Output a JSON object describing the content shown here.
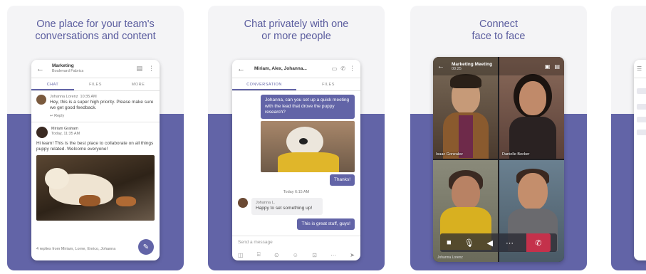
{
  "cards": [
    {
      "title_line1": "One place for your team's",
      "title_line2": "conversations and content",
      "phone": {
        "channel_name": "Marketing",
        "channel_sub": "Boulevard Fabrics",
        "tabs": [
          "CHAT",
          "FILES",
          "MORE"
        ],
        "post1_author": "Johanna Lorenz",
        "post1_time": "10:35 AM",
        "post1_text": "Hey, this is a super high priority. Please make sure we get good feedback.",
        "reply_label": "Reply",
        "post2_author": "Miriam Graham",
        "post2_time": "Today, 11:35 AM",
        "post2_text": "Hi team! This is the best place to collaborate on all things puppy related. Welcome everyone!",
        "likes_text": "4 replies from Miriam, Lorne, Enrico, Johanna"
      }
    },
    {
      "title_line1": "Chat privately with one",
      "title_line2": "or more people",
      "phone": {
        "chat_name": "Miriam, Alex, Johanna...",
        "tabs": [
          "CONVERSATION",
          "FILES"
        ],
        "msg1": "Johanna, can you set up a quick meeting with the lead that drove the puppy research?",
        "msg2": "Thanks!",
        "time_sep": "Today 6:15 AM",
        "reply_author": "Johanna L.",
        "reply_text": "Happy to set something up!",
        "msg3": "This is great stuff, guys!",
        "compose_placeholder": "Send a message"
      }
    },
    {
      "title_line1": "Connect",
      "title_line2": "face to face",
      "phone": {
        "meeting_title": "Marketing Meeting",
        "meeting_time": "00:25",
        "names": [
          "Isaac Gonzalez",
          "Danielle Becker",
          "",
          ""
        ],
        "footer_name": "Johanna Lorenz"
      }
    }
  ],
  "colors": {
    "brand": "#6264a7",
    "end_call": "#c4314b"
  },
  "icons": [
    "back-arrow-icon",
    "video-icon",
    "phone-icon",
    "more-icon",
    "mic-icon",
    "speaker-icon",
    "end-call-icon",
    "compose-icon",
    "attach-icon"
  ]
}
